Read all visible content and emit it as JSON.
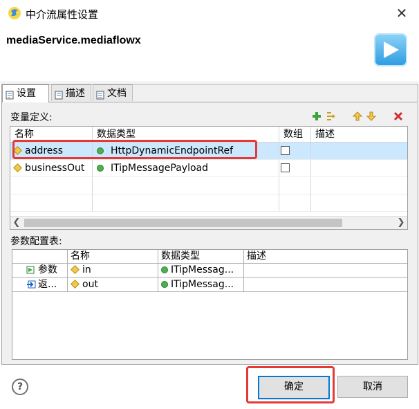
{
  "window": {
    "title": "中介流属性设置",
    "close_symbol": "✕"
  },
  "header": {
    "title": "mediaService.mediaflowx"
  },
  "tabs": [
    {
      "label": "设置",
      "icon": "settings-page-icon",
      "active": true
    },
    {
      "label": "描述",
      "icon": "description-page-icon",
      "active": false
    },
    {
      "label": "文档",
      "icon": "document-page-icon",
      "active": false
    }
  ],
  "variables": {
    "section_label": "变量定义:",
    "toolbar": {
      "add": "add-icon",
      "insert": "insert-icon",
      "move_up": "move-up-icon",
      "move_down": "move-down-icon",
      "delete": "delete-icon"
    },
    "columns": [
      "名称",
      "数据类型",
      "数组",
      "描述"
    ],
    "rows": [
      {
        "name": "address",
        "type": "HttpDynamicEndpointRef",
        "array": false,
        "desc": "",
        "selected": true
      },
      {
        "name": "businessOut",
        "type": "ITipMessagePayload",
        "array": false,
        "desc": "",
        "selected": false
      }
    ]
  },
  "params": {
    "section_label": "参数配置表:",
    "columns": [
      "",
      "名称",
      "数据类型",
      "描述"
    ],
    "rows": [
      {
        "kind": "参数",
        "name": "in",
        "type": "ITipMessag...",
        "desc": ""
      },
      {
        "kind": "返...",
        "name": "out",
        "type": "ITipMessag...",
        "desc": ""
      }
    ]
  },
  "footer": {
    "help_symbol": "?",
    "ok_label": "确定",
    "cancel_label": "取消"
  },
  "colors": {
    "selection": "#cce8ff",
    "highlight": "#e53935",
    "default_button_border": "#0078d7"
  }
}
